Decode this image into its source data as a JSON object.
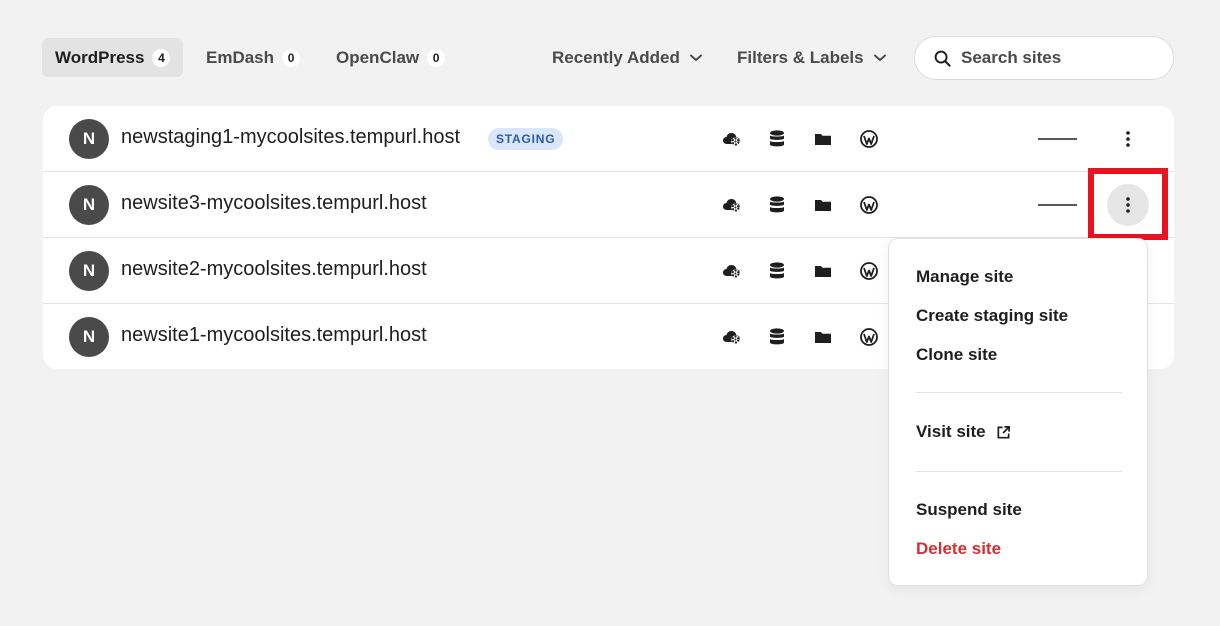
{
  "tabs": [
    {
      "label": "WordPress",
      "count": "4"
    },
    {
      "label": "EmDash",
      "count": "0"
    },
    {
      "label": "OpenClaw",
      "count": "0"
    }
  ],
  "sort": {
    "label": "Recently Added"
  },
  "filters": {
    "label": "Filters & Labels"
  },
  "search": {
    "placeholder": "Search sites",
    "icon": "search-icon"
  },
  "sites": [
    {
      "initial": "N",
      "name": "newstaging1-mycoolsites.tempurl.host",
      "badge": "STAGING"
    },
    {
      "initial": "N",
      "name": "newsite3-mycoolsites.tempurl.host",
      "badge": ""
    },
    {
      "initial": "N",
      "name": "newsite2-mycoolsites.tempurl.host",
      "badge": ""
    },
    {
      "initial": "N",
      "name": "newsite1-mycoolsites.tempurl.host",
      "badge": ""
    }
  ],
  "row_icons": [
    "cloud-gear-icon",
    "database-icon",
    "folder-icon",
    "wordpress-icon"
  ],
  "menu": {
    "manage": "Manage site",
    "create_staging": "Create staging site",
    "clone": "Clone site",
    "visit": "Visit site",
    "suspend": "Suspend site",
    "delete": "Delete site"
  },
  "colors": {
    "accent_badge_bg": "#d9e6fb",
    "accent_badge_text": "#2e5aa8",
    "danger": "#d32f2f",
    "highlight": "#e8141f"
  }
}
